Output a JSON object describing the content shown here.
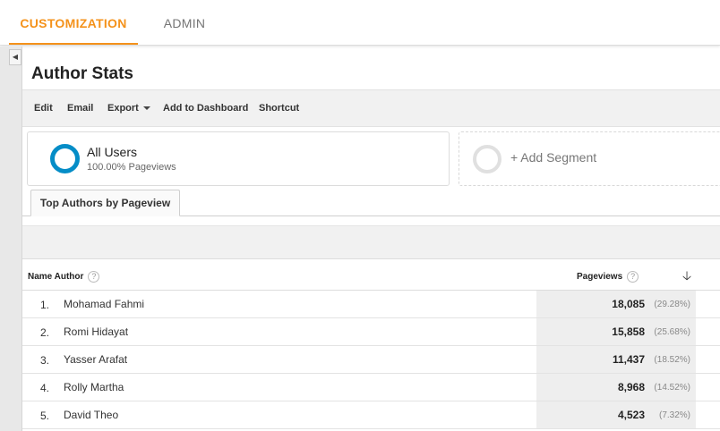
{
  "nav": {
    "customization": "CUSTOMIZATION",
    "admin": "ADMIN"
  },
  "page": {
    "title": "Author Stats"
  },
  "toolbar": {
    "edit": "Edit",
    "email": "Email",
    "export": "Export",
    "add_to_dashboard": "Add to Dashboard",
    "shortcut": "Shortcut"
  },
  "segments": {
    "active_name": "All Users",
    "active_sub": "100.00% Pageviews",
    "add_label": "+ Add Segment"
  },
  "report_tab": "Top Authors by Pageview",
  "table": {
    "col_name": "Name Author",
    "col_pageviews": "Pageviews",
    "help_glyph": "?",
    "sort_glyph": "🡣",
    "rows": [
      {
        "index": "1.",
        "name": "Mohamad Fahmi",
        "pageviews": "18,085",
        "percent": "(29.28%)"
      },
      {
        "index": "2.",
        "name": "Romi Hidayat",
        "pageviews": "15,858",
        "percent": "(25.68%)"
      },
      {
        "index": "3.",
        "name": "Yasser Arafat",
        "pageviews": "11,437",
        "percent": "(18.52%)"
      },
      {
        "index": "4.",
        "name": "Rolly Martha",
        "pageviews": "8,968",
        "percent": "(14.52%)"
      },
      {
        "index": "5.",
        "name": "David Theo",
        "pageviews": "4,523",
        "percent": "(7.32%)"
      }
    ]
  },
  "colors": {
    "accent_orange": "#f4921b",
    "segment_blue": "#058dc7"
  },
  "icons": {
    "collapse": "chevron-left-icon",
    "segment": "donut-icon",
    "sort": "arrow-down-icon",
    "help": "help-icon"
  }
}
